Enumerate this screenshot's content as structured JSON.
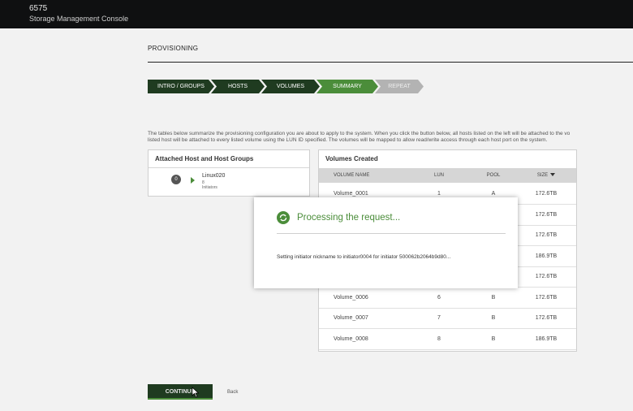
{
  "header": {
    "model": "6575",
    "console_name": "Storage Management Console"
  },
  "page": {
    "title": "PROVISIONING"
  },
  "steps": [
    {
      "label": "INTRO / GROUPS",
      "state": "done"
    },
    {
      "label": "HOSTS",
      "state": "done"
    },
    {
      "label": "VOLUMES",
      "state": "done"
    },
    {
      "label": "SUMMARY",
      "state": "active"
    },
    {
      "label": "REPEAT",
      "state": "disabled"
    }
  ],
  "summary": {
    "line1": "The tables below summarize the provisioning configuration you are about to apply to the system. When you click the button below, all hosts listed on the left will be attached to the vo",
    "line2": "listed host will be attached to every listed volume using the LUN ID specified. The volumes will be mapped to allow read/write access through each host port on the system."
  },
  "hosts_panel": {
    "title": "Attached Host and Host Groups",
    "hosts": [
      {
        "badge": "0",
        "name": "Linux020",
        "initiators": "8 Initiators"
      }
    ]
  },
  "volumes_panel": {
    "title": "Volumes Created",
    "columns": {
      "name": "VOLUME NAME",
      "lun": "LUN",
      "pool": "POOL",
      "size": "SIZE"
    },
    "rows": [
      {
        "name": "Volume_0001",
        "lun": "1",
        "pool": "A",
        "size": "172.6TB"
      },
      {
        "name": "",
        "lun": "",
        "pool": "",
        "size": "172.6TB"
      },
      {
        "name": "",
        "lun": "",
        "pool": "",
        "size": "172.6TB"
      },
      {
        "name": "",
        "lun": "",
        "pool": "",
        "size": "186.9TB"
      },
      {
        "name": "",
        "lun": "",
        "pool": "",
        "size": "172.6TB"
      },
      {
        "name": "Volume_0006",
        "lun": "6",
        "pool": "B",
        "size": "172.6TB"
      },
      {
        "name": "Volume_0007",
        "lun": "7",
        "pool": "B",
        "size": "172.6TB"
      },
      {
        "name": "Volume_0008",
        "lun": "8",
        "pool": "B",
        "size": "186.9TB"
      }
    ]
  },
  "actions": {
    "continue_label": "CONTINUE",
    "back_label": "Back"
  },
  "modal": {
    "title": "Processing the request...",
    "message": "Setting initiator nickname to initiator0004 for initiator 500062b2064b9d80..."
  },
  "colors": {
    "accent": "#4b8d3a",
    "dark_green": "#1f3b20",
    "topbar": "#0f1011"
  }
}
